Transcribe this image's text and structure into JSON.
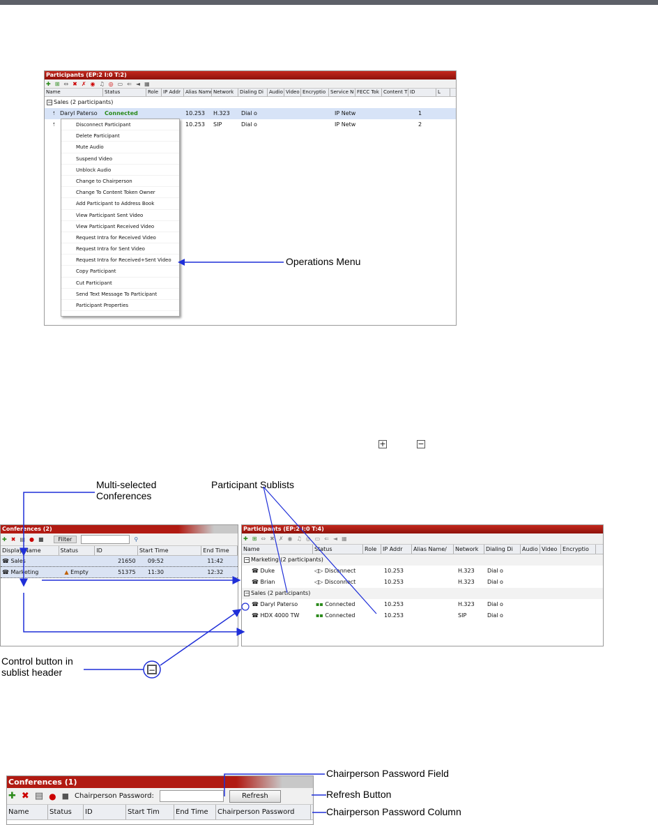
{
  "fig1": {
    "title": "Participants (EP:2 I:0 T:2)",
    "columns": [
      "Name",
      "Status",
      "Role",
      "IP Addr",
      "Alias Name/",
      "Network",
      "Dialing Di",
      "Audio",
      "Video",
      "Encryptio",
      "Service N",
      "FECC Tok",
      "Content T",
      "ID",
      "L"
    ],
    "group": "Sales (2 participants)",
    "rows": [
      {
        "name": "Daryl Paterso",
        "status": "Connected",
        "ip": "10.253",
        "network": "H.323",
        "dial": "Dial o",
        "service": "IP Netw",
        "id": "1"
      },
      {
        "name": "",
        "status": "",
        "ip": "10.253",
        "network": "SIP",
        "dial": "Dial o",
        "service": "IP Netw",
        "id": "2"
      }
    ],
    "menu": [
      "Disconnect Participant",
      "Delete Participant",
      "Mute Audio",
      "Suspend Video",
      "Unblock Audio",
      "Change to Chairperson",
      "Change To Content Token Owner",
      "Add Participant to Address Book",
      "View Participant Sent Video",
      "View Participant Received Video",
      "Request Intra for Received Video",
      "Request Intra for Sent Video",
      "Request Intra for Received+Sent Video",
      "Copy Participant",
      "Cut Participant",
      "Send Text Message To Participant",
      "Participant Properties"
    ],
    "callout": "Operations Menu"
  },
  "fig2": {
    "conf_title": "Conferences (2)",
    "filter_label": "Filter",
    "conf_columns": [
      "Display Name",
      "Status",
      "ID",
      "Start Time",
      "End Time"
    ],
    "conferences": [
      {
        "name": "Sales",
        "status": "",
        "id": "21650",
        "start": "09:52",
        "end": "11:42"
      },
      {
        "name": "Marketing",
        "status": "Empty",
        "id": "51375",
        "start": "11:30",
        "end": "12:32"
      }
    ],
    "part_title": "Participants (EP:2 I:0 T:4)",
    "part_columns": [
      "Name",
      "Status",
      "Role",
      "IP Addr",
      "Alias Name/",
      "Network",
      "Dialing Di",
      "Audio",
      "Video",
      "Encryptio"
    ],
    "groups": [
      {
        "label": "Marketing (2 participants)",
        "rows": [
          {
            "name": "Duke",
            "status": "Disconnect",
            "ip": "10.253",
            "network": "H.323",
            "dial": "Dial o"
          },
          {
            "name": "Brian",
            "status": "Disconnect",
            "ip": "10.253",
            "network": "H.323",
            "dial": "Dial o"
          }
        ]
      },
      {
        "label": "Sales (2 participants)",
        "rows": [
          {
            "name": "Daryl Paterso",
            "status": "Connected",
            "ip": "10.253",
            "network": "H.323",
            "dial": "Dial o"
          },
          {
            "name": "HDX 4000 TW",
            "status": "Connected",
            "ip": "10.253",
            "network": "SIP",
            "dial": "Dial o"
          }
        ]
      }
    ],
    "callouts": {
      "multi": "Multi-selected\nConferences",
      "sublists": "Participant Sublists",
      "control": "Control button in\nsublist header"
    }
  },
  "fig3": {
    "title": "Conferences (1)",
    "pwd_label": "Chairperson Password:",
    "pwd_value": "",
    "refresh": "Refresh",
    "columns": [
      "Name",
      "Status",
      "ID",
      "Start Tim",
      "End Time",
      "Chairperson Password"
    ],
    "callouts": {
      "field": "Chairperson Password Field",
      "refresh": "Refresh Button",
      "column": "Chairperson Password Column"
    }
  },
  "icons": {
    "plus": "plus-box-icon",
    "minus": "minus-box-icon"
  },
  "colors": {
    "title_red": "#b11a12",
    "callout_blue": "#1f2fd8",
    "connected_green": "#2a8a1a"
  }
}
